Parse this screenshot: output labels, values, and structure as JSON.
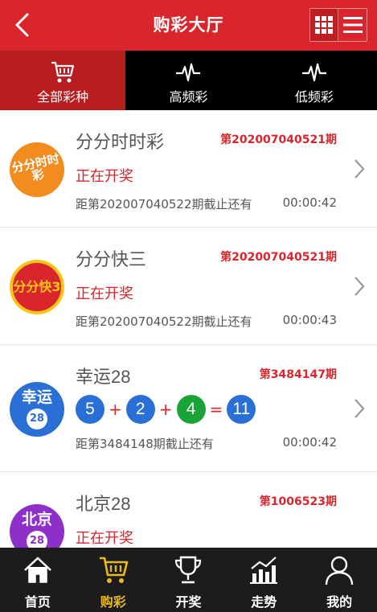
{
  "header": {
    "title": "购彩大厅"
  },
  "tabs": [
    {
      "label": "全部彩种",
      "icon": "cart-icon",
      "active": true
    },
    {
      "label": "高频彩",
      "icon": "pulse-icon",
      "active": false
    },
    {
      "label": "低频彩",
      "icon": "pulse-icon",
      "active": false
    }
  ],
  "lotteries": [
    {
      "name": "分分时时彩",
      "period": "第202007040521期",
      "status": "正在开奖",
      "deadline": "距第202007040522期截止还有",
      "countdown": "00:00:42",
      "logo_text": "分分时时彩",
      "logo_color": "#f28c1e"
    },
    {
      "name": "分分快三",
      "period": "第202007040521期",
      "status": "正在开奖",
      "deadline": "距第202007040522期截止还有",
      "countdown": "00:00:43",
      "logo_text": "分分快3",
      "logo_color": "#f5c518"
    },
    {
      "name": "幸运28",
      "period": "第3484147期",
      "balls": [
        {
          "value": "5",
          "color": "blue"
        },
        {
          "value": "2",
          "color": "blue"
        },
        {
          "value": "4",
          "color": "green"
        }
      ],
      "ops": [
        "+",
        "+",
        "="
      ],
      "sum": "11",
      "deadline": "距第3484148期截止还有",
      "countdown": "00:00:42",
      "logo_text": "幸运",
      "logo_number": "28",
      "logo_color": "#2a6fd6"
    },
    {
      "name": "北京28",
      "period": "第1006523期",
      "status": "正在开奖",
      "logo_text": "北京",
      "logo_number": "28",
      "logo_color": "#8e2fc9"
    }
  ],
  "bottom_nav": [
    {
      "label": "首页",
      "icon": "home-icon",
      "active": false
    },
    {
      "label": "购彩",
      "icon": "cart-icon",
      "active": true
    },
    {
      "label": "开奖",
      "icon": "trophy-icon",
      "active": false
    },
    {
      "label": "走势",
      "icon": "trend-icon",
      "active": false
    },
    {
      "label": "我的",
      "icon": "user-icon",
      "active": false
    }
  ],
  "colors": {
    "primary": "#d9252b",
    "tab_active": "#b81d20",
    "nav_active": "#e8b923"
  }
}
